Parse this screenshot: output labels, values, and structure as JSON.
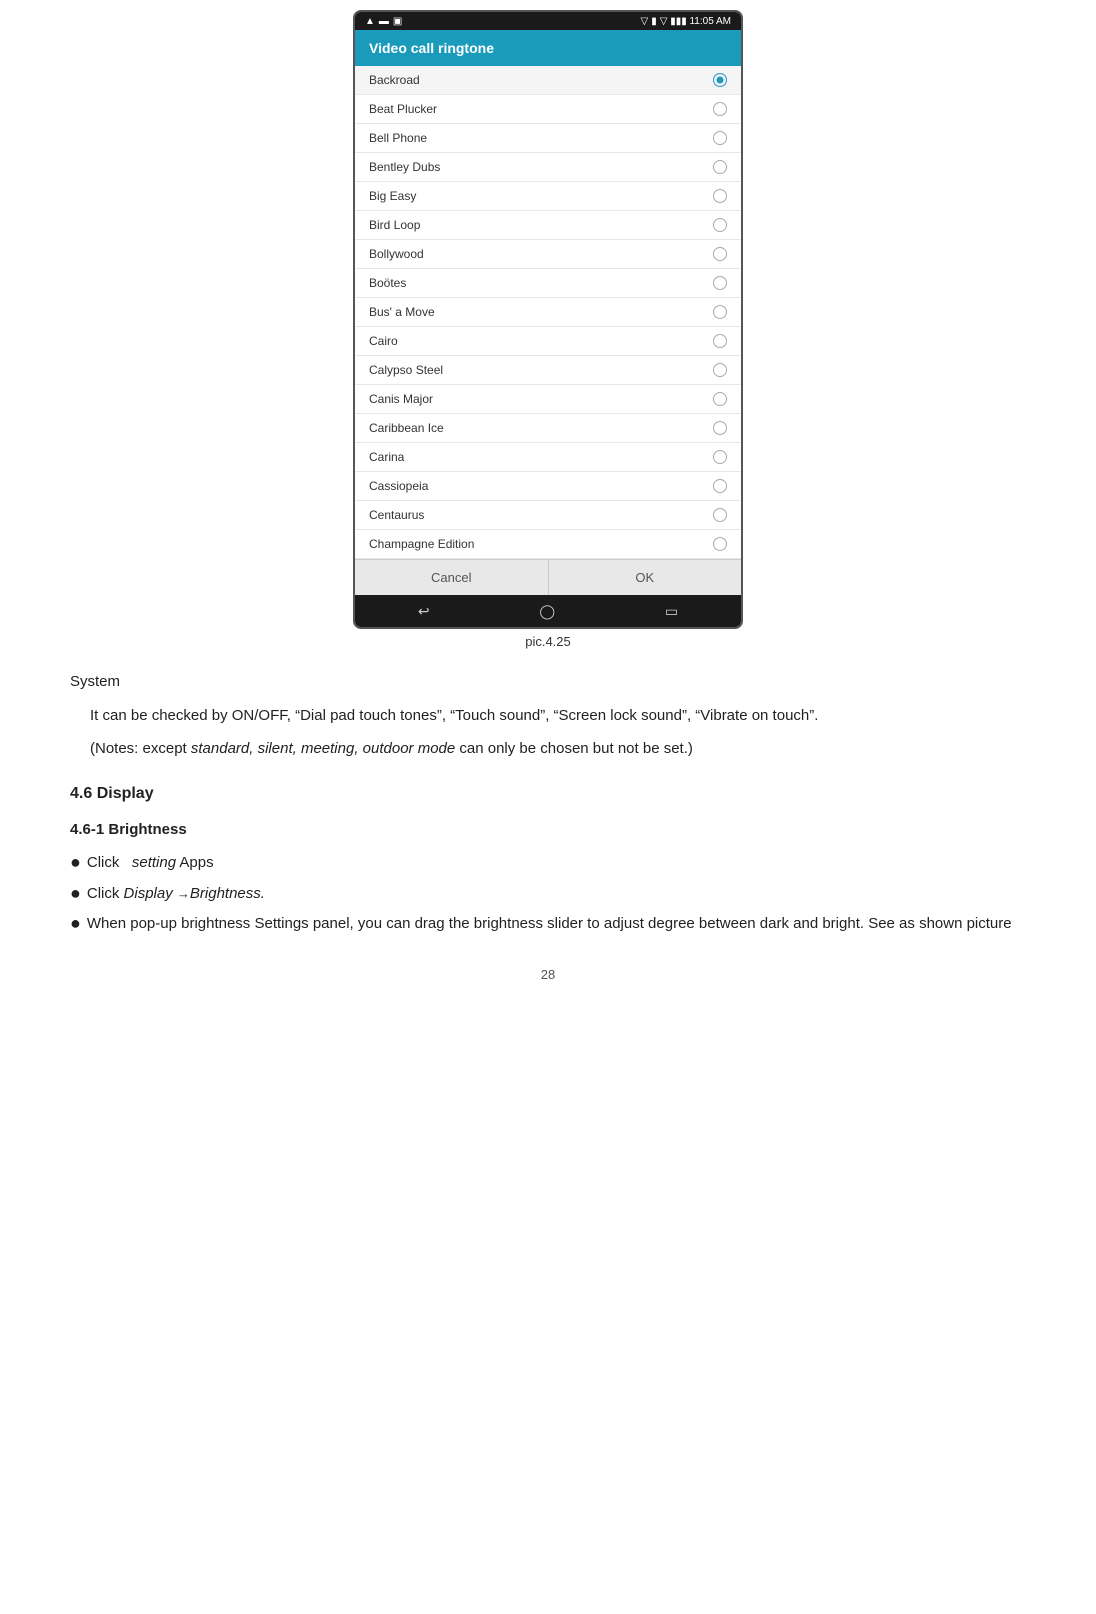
{
  "caption": "pic.4.25",
  "phone": {
    "status_bar": {
      "left_icons": "▲ ▬ ▣",
      "right_icons": "▽ ▮▮▮ 11:05 AM"
    },
    "dialog_title": "Video call ringtone",
    "ringtones": [
      {
        "name": "Backroad",
        "selected": true
      },
      {
        "name": "Beat Plucker",
        "selected": false
      },
      {
        "name": "Bell Phone",
        "selected": false
      },
      {
        "name": "Bentley Dubs",
        "selected": false
      },
      {
        "name": "Big Easy",
        "selected": false
      },
      {
        "name": "Bird Loop",
        "selected": false
      },
      {
        "name": "Bollywood",
        "selected": false
      },
      {
        "name": "Boötes",
        "selected": false
      },
      {
        "name": "Bus' a Move",
        "selected": false
      },
      {
        "name": "Cairo",
        "selected": false
      },
      {
        "name": "Calypso Steel",
        "selected": false
      },
      {
        "name": "Canis Major",
        "selected": false
      },
      {
        "name": "Caribbean Ice",
        "selected": false
      },
      {
        "name": "Carina",
        "selected": false
      },
      {
        "name": "Cassiopeia",
        "selected": false
      },
      {
        "name": "Centaurus",
        "selected": false
      },
      {
        "name": "Champagne Edition",
        "selected": false
      }
    ],
    "buttons": {
      "cancel": "Cancel",
      "ok": "OK"
    }
  },
  "body_text": {
    "system_label": "System",
    "system_desc": "It can be checked by ON/OFF, “Dial pad touch tones”, “Touch sound”, “Screen lock sound”, “Vibrate on touch”.",
    "notes": "(Notes: except standard, silent, meeting, outdoor mode can only be chosen but not be set.)",
    "section_46": "4.6 Display",
    "subsection_461": "4.6-1 Brightness",
    "bullet1": "Click   setting Apps",
    "bullet2": "Click Display →Brightness.",
    "bullet3": "When pop-up brightness Settings panel, you can drag the brightness slider to adjust degree between dark and bright. See as shown picture"
  },
  "page_number": "28"
}
